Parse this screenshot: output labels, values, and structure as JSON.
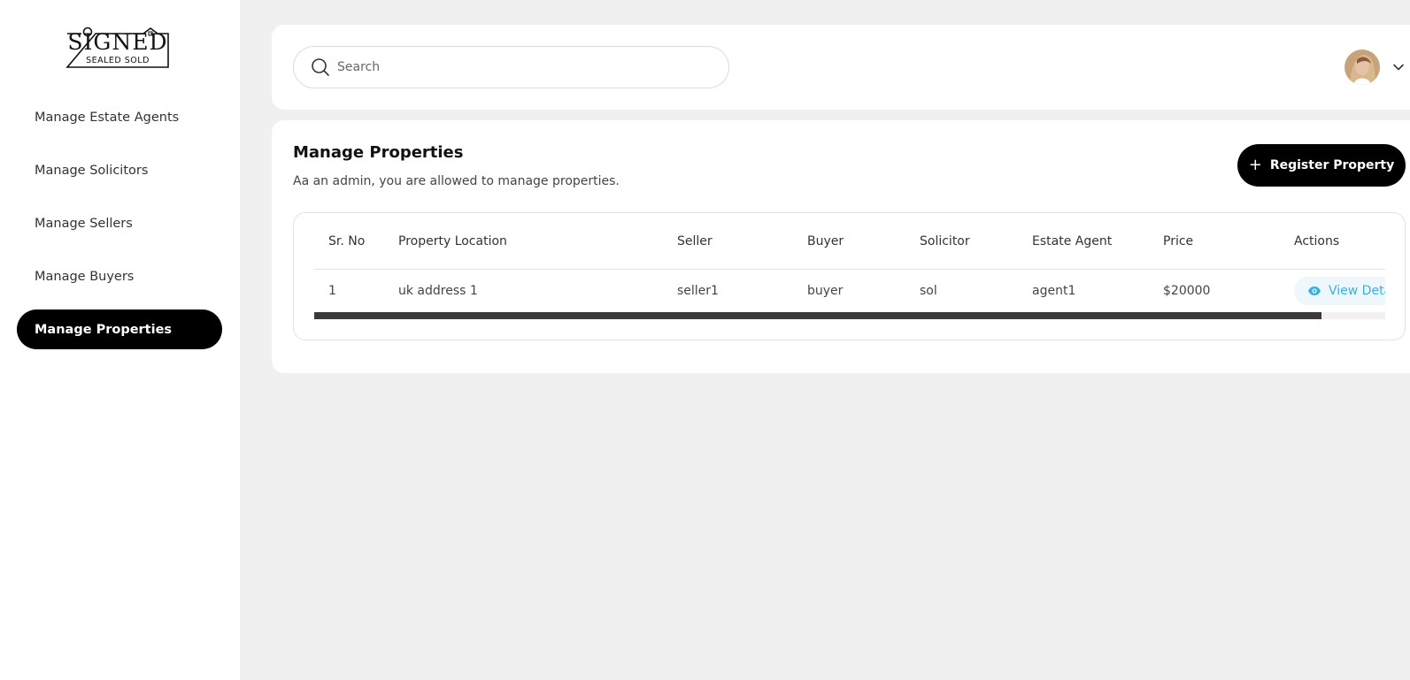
{
  "brand": {
    "logo_main": "SIGNED",
    "logo_sub": "SEALED SOLD"
  },
  "sidebar": {
    "items": [
      {
        "label": "Manage Estate Agents",
        "active": false
      },
      {
        "label": "Manage Solicitors",
        "active": false
      },
      {
        "label": "Manage Sellers",
        "active": false
      },
      {
        "label": "Manage Buyers",
        "active": false
      },
      {
        "label": "Manage Properties",
        "active": true
      }
    ]
  },
  "topbar": {
    "search_placeholder": "Search",
    "search_icon": "search-icon",
    "user_menu_icon": "chevron-down-icon"
  },
  "main": {
    "title": "Manage Properties",
    "subtitle": "Aa an admin, you are allowed to manage properties.",
    "register_button": {
      "icon": "+",
      "label": "Register Property"
    },
    "table": {
      "columns": [
        "Sr. No",
        "Property Location",
        "Seller",
        "Buyer",
        "Solicitor",
        "Estate Agent",
        "Price",
        "Actions"
      ],
      "rows": [
        {
          "sr_no": "1",
          "location": "uk address 1",
          "seller": "seller1",
          "buyer": "buyer",
          "solicitor": "sol",
          "estate_agent": "agent1",
          "price": "$20000",
          "action_label": "View Details"
        }
      ]
    }
  },
  "colors": {
    "accent": "#000000",
    "background": "#f0f0f0",
    "link": "#3ab0e0"
  }
}
